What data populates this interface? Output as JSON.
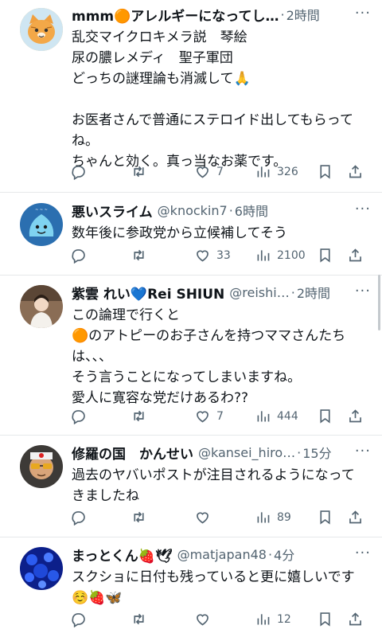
{
  "more_label": "···",
  "tweets": [
    {
      "name": "mmm🟠アレルギーになってし…",
      "handle": "",
      "dot": "·",
      "time": "2時間",
      "lines": [
        "乱交マイクロキメラ説　琴絵",
        "尿の膿レメディ　聖子軍団",
        "どっちの謎理論も消滅して🙏",
        "",
        "お医者さんで普通にステロイド出してもらって",
        "ね。",
        "ちゃんと効く。真っ当なお薬です。"
      ],
      "replies": "",
      "retweets": "",
      "likes": "7",
      "views": "326"
    },
    {
      "name": "悪いスライム",
      "handle": "@knockin7",
      "dot": "·",
      "time": "6時間",
      "lines": [
        "数年後に参政党から立候補してそう"
      ],
      "replies": "",
      "retweets": "",
      "likes": "33",
      "views": "2100"
    },
    {
      "name": "紫雲 れい💙Rei SHIUN",
      "handle": "@reishi…",
      "dot": "·",
      "time": "2時間",
      "lines": [
        "この論理で行くと",
        "🟠のアトピーのお子さんを持つママさんたち",
        "は、、、",
        "そう言うことになってしまいますね。",
        "愛人に寛容な党だけあるわ??"
      ],
      "replies": "",
      "retweets": "",
      "likes": "7",
      "views": "444"
    },
    {
      "name": "修羅の国　かんせい",
      "handle": "@kansei_hiro…",
      "dot": "·",
      "time": "15分",
      "lines": [
        "過去のヤバいポストが注目されるようになって",
        "きましたね"
      ],
      "replies": "",
      "retweets": "",
      "likes": "",
      "views": "89"
    },
    {
      "name": "まっとくん🍓🕊",
      "handle": "@matjapan48",
      "dot": "·",
      "time": "4分",
      "lines": [
        "スクショに日付も残っていると更に嬉しいです",
        "☺️🍓🦋"
      ],
      "replies": "",
      "retweets": "",
      "likes": "",
      "views": "12"
    }
  ],
  "icons": {
    "reply": "reply-icon",
    "retweet": "retweet-icon",
    "like": "heart-icon",
    "views": "views-icon",
    "bookmark": "bookmark-icon",
    "share": "share-icon"
  },
  "colors": {
    "text": "#0f1419",
    "muted": "#536471",
    "divider": "#e6e8ea"
  }
}
